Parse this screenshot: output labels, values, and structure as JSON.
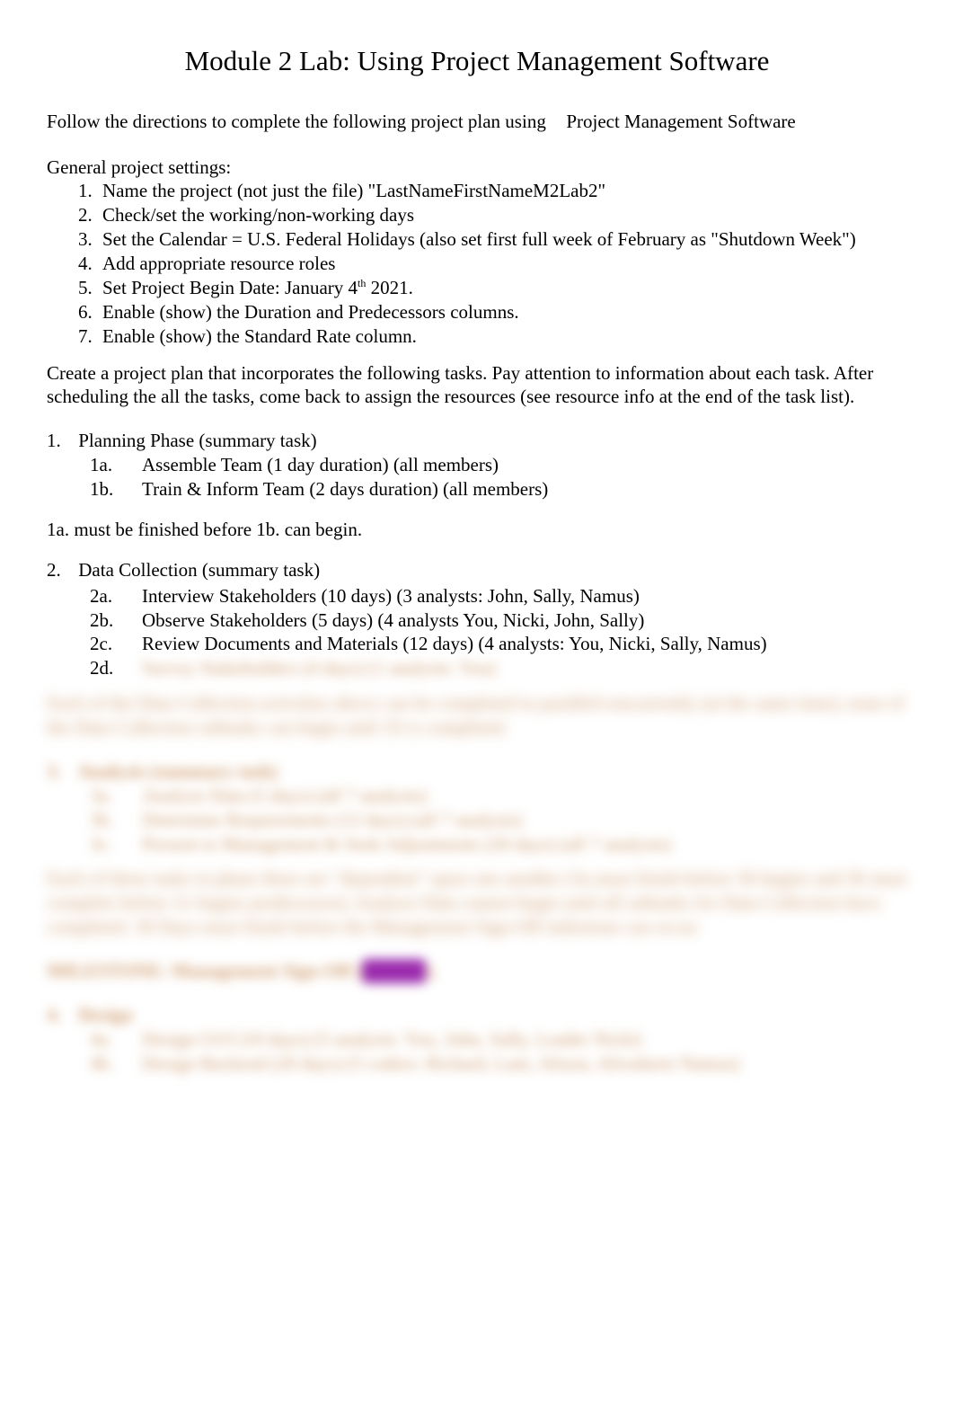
{
  "document": {
    "title": "Module 2 Lab: Using Project Management Software",
    "intro_prefix": "Follow the directions to complete the following project plan using",
    "intro_suffix": "Project Management Software",
    "general_settings_label": "General project settings:",
    "general_settings": [
      "Name the project (not just the file) \"LastNameFirstNameM2Lab2\"",
      "Check/set the working/non-working days",
      "Set the Calendar = U.S. Federal Holidays (also set first full week of February as \"Shutdown Week\")",
      "Add appropriate resource roles",
      "Set Project Begin Date: January 4",
      " 2021.",
      "Enable (show) the Duration and Predecessors columns.",
      "Enable (show) the Standard Rate column."
    ],
    "date_sup": "th",
    "create_plan_paragraph": "Create a project plan that incorporates the following tasks. Pay attention to information about each task. After scheduling the all the tasks, come back to assign the resources (see resource info at the end of the task list).",
    "phase1": {
      "num": "1.",
      "title": "Planning Phase (summary task)",
      "subtasks": [
        {
          "idx": "1a.",
          "text": "Assemble Team (1 day duration) (all members)"
        },
        {
          "idx": "1b.",
          "text": "Train & Inform Team (2 days duration) (all members)"
        }
      ],
      "note": "1a. must be finished before 1b. can begin."
    },
    "phase2": {
      "num": "2.",
      "title": "Data Collection (summary task)",
      "subtasks": [
        {
          "idx": "2a.",
          "text": "Interview Stakeholders (10 days) (3 analysts: John, Sally, Namus)"
        },
        {
          "idx": "2b.",
          "text": "Observe Stakeholders (5 days) (4 analysts You, Nicki, John, Sally)"
        },
        {
          "idx": "2c.",
          "text": "Review Documents and Materials (12 days) (4 analysts: You, Nicki, Sally, Namus)"
        },
        {
          "idx": "2d.",
          "text": "Survey Stakeholders (4 days) (1 analysts: You)"
        }
      ],
      "note": "Each of the Data Collection activities above can be completed in parallel/concurrently (at the same time); none of the Data Collection subtasks can begin until 1b is completed."
    },
    "phase3": {
      "num": "3.",
      "title": "Analysis (summary task)",
      "subtasks": [
        {
          "idx": "3a.",
          "text": "Analyze Data (5 days) (all 7 analysts)"
        },
        {
          "idx": "3b.",
          "text": "Determine Requirements (12 days) (all 7 analysts)"
        },
        {
          "idx": "3c.",
          "text": "Present to Management & Seek Adjustments (20 days) (all 7 analysts)"
        }
      ],
      "note": "Each of these tasks in phase three are \"dependent\" upon one another (3a must finish before 3b begins and 3b must complete before 3c begins predecessor);   Analyze Data cannot begin until all subtasks for Data Collection have completed.  30 Days must finish before the Management Sign-Off milestone can occur."
    },
    "milestone": {
      "label_prefix": "MILESTONE: Management Sign-Off (",
      "pill_text": "xxxxxx",
      "label_suffix": ")."
    },
    "phase4": {
      "num": "4.",
      "title": "Design",
      "subtasks": [
        {
          "idx": "4a.",
          "text": "Design GUI (10 days) (5 analysts: You, John, Sally, Leader Nicki)"
        },
        {
          "idx": "4b.",
          "text": "Design Backend (20 days) (5 coders: Richard, Lani, Alison, Afrosheen Namus)"
        }
      ]
    }
  }
}
